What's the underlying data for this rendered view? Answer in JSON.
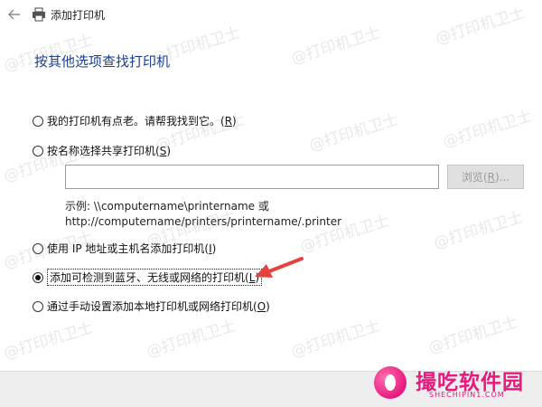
{
  "window": {
    "title": "添加打印机"
  },
  "page": {
    "heading": "按其他选项查找打印机"
  },
  "options": [
    {
      "label": "我的打印机有点老。请帮我找到它。(",
      "key": "R",
      "tail": ")",
      "checked": false
    },
    {
      "label": "按名称选择共享打印机(",
      "key": "S",
      "tail": ")",
      "checked": false
    },
    {
      "label": "使用 IP 地址或主机名添加打印机(",
      "key": "I",
      "tail": ")",
      "checked": false
    },
    {
      "label": "添加可检测到蓝牙、无线或网络的打印机(",
      "key": "L",
      "tail": ")",
      "checked": true
    },
    {
      "label": "通过手动设置添加本地打印机或网络打印机(",
      "key": "O",
      "tail": ")",
      "checked": false
    }
  ],
  "share": {
    "input_value": "",
    "browse_label_pre": "浏览(",
    "browse_key": "R",
    "browse_label_post": ")...",
    "example_line1": "示例: \\\\computername\\printername 或",
    "example_line2": "http://computername/printers/printername/.printer"
  },
  "watermark": {
    "text": "@打印机卫士"
  },
  "logo": {
    "name": "撮吃软件园",
    "url": "SHECHIPIN1.COM"
  },
  "colors": {
    "heading": "#1a3f8f",
    "arrow": "#e8413c",
    "logo": "#e8197f"
  },
  "icons": {
    "back": "back-arrow-icon",
    "printer": "printer-icon",
    "annotation": "red-arrow-icon"
  }
}
